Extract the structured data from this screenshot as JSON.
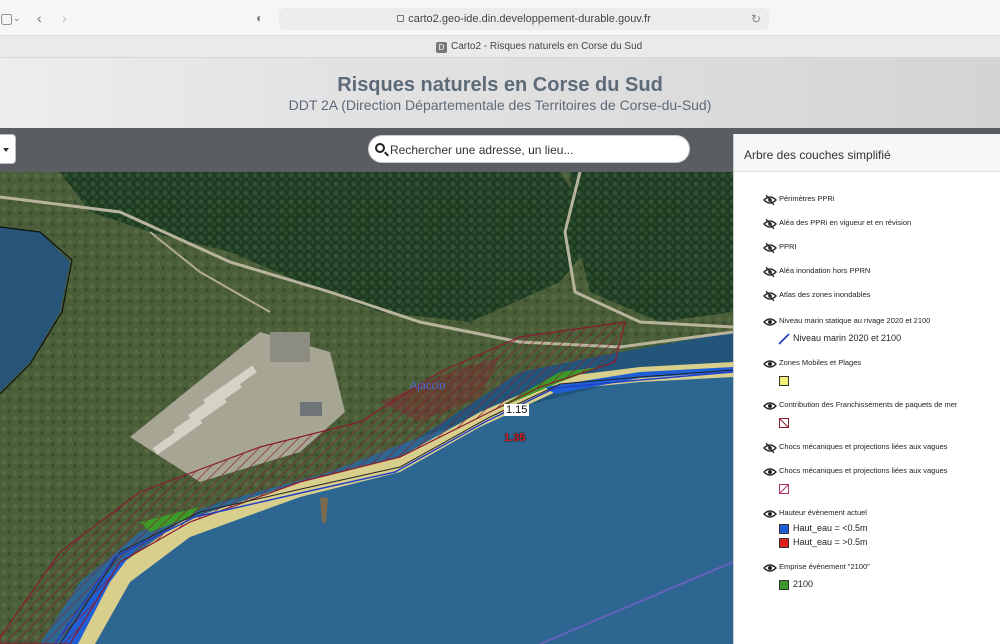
{
  "browser": {
    "url": "carto2.geo-ide.din.developpement-durable.gouv.fr",
    "tab_title": "Carto2 - Risques naturels en Corse du Sud",
    "tab_favicon_letter": "D"
  },
  "header": {
    "title": "Risques naturels en Corse du Sud",
    "subtitle": "DDT 2A (Direction Départementale des Territoires de Corse-du-Sud)"
  },
  "search": {
    "placeholder": "Rechercher une adresse, un lieu..."
  },
  "map": {
    "place_label": "Ajaccio",
    "value_label_1": "1.15",
    "value_label_2": "1.35"
  },
  "layer_panel": {
    "title": "Arbre des couches simplifié",
    "layers": [
      {
        "label": "Périmètres PPRi",
        "visible": false
      },
      {
        "label": "Aléa des PPRi en vigueur et en révision",
        "visible": false
      },
      {
        "label": "PPRI",
        "visible": false
      },
      {
        "label": "Aléa inondation hors PPRN",
        "visible": false
      },
      {
        "label": "Atlas des zones inondables",
        "visible": false
      },
      {
        "label": "Niveau marin statique au rivage 2020 et 2100",
        "visible": true
      },
      {
        "label": "Zones Mobiles et Plages",
        "visible": true
      },
      {
        "label": "Contribution des Franchissements de paquets de mer",
        "visible": true
      },
      {
        "label": "Chocs mécaniques et projections liées aux vagues",
        "visible": false
      },
      {
        "label": "Chocs mécaniques et projections liées aux vagues",
        "visible": true
      },
      {
        "label": "Hauteur évènement actuel",
        "visible": true
      },
      {
        "label": "Emprise évènement \"2100\"",
        "visible": true
      }
    ],
    "legend": {
      "niveau_marin": "Niveau marin 2020 et 2100",
      "haut_eau_low": "Haut_eau = <0.5m",
      "haut_eau_high": "Haut_eau = >0.5m",
      "emprise_2100": "2100"
    }
  },
  "colors": {
    "zones_mobiles": "#f4f07a",
    "haut_eau_low": "#1f5fd6",
    "haut_eau_high": "#e0201c",
    "emprise_2100": "#3c9a28",
    "niveau_marin_line": "#2340c8",
    "hatch": "#8a1c2c"
  }
}
